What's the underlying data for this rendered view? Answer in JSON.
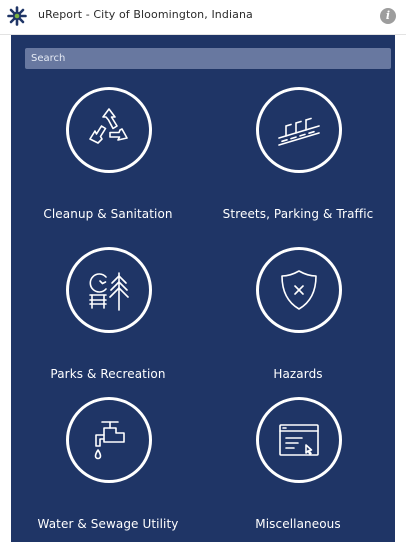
{
  "header": {
    "title": "uReport - City of Bloomington, Indiana",
    "info_glyph": "i"
  },
  "search": {
    "placeholder": "Search"
  },
  "categories": [
    {
      "label": "Cleanup & Sanitation",
      "icon": "recycle-icon"
    },
    {
      "label": "Streets, Parking & Traffic",
      "icon": "road-icon"
    },
    {
      "label": "Parks & Recreation",
      "icon": "park-bench-tree-icon"
    },
    {
      "label": "Hazards",
      "icon": "shield-x-icon"
    },
    {
      "label": "Water & Sewage Utility",
      "icon": "faucet-icon"
    },
    {
      "label": "Miscellaneous",
      "icon": "browser-window-icon"
    }
  ],
  "colors": {
    "panel_background": "#1f3566",
    "search_background": "#6878a0",
    "icon_stroke": "#ffffff"
  }
}
